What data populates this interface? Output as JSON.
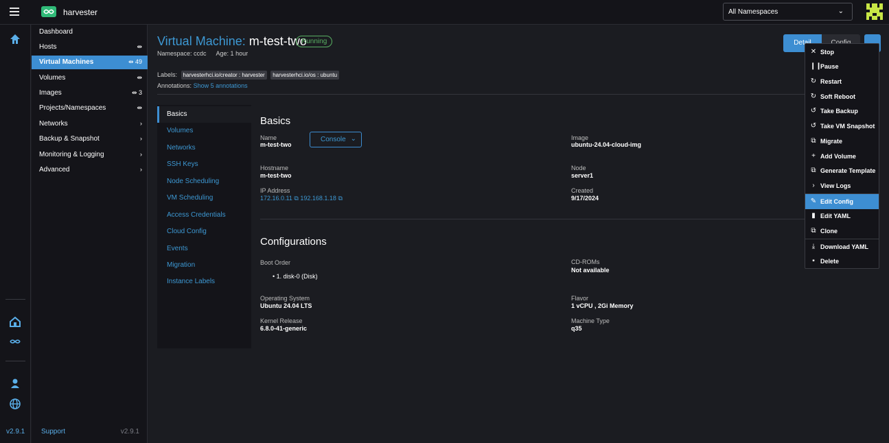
{
  "app": {
    "brand": "harvester",
    "namespace_select": "All Namespaces",
    "rail_version": "v2.9.1"
  },
  "sidebar": {
    "items": [
      {
        "label": "Dashboard",
        "count": ""
      },
      {
        "label": "Hosts",
        "count": "⇹"
      },
      {
        "label": "Virtual Machines",
        "count": "⇹ 49"
      },
      {
        "label": "Volumes",
        "count": "⇹"
      },
      {
        "label": "Images",
        "count": "⇹ 3"
      },
      {
        "label": "Projects/Namespaces",
        "count": "⇹"
      },
      {
        "label": "Networks",
        "count": "›"
      },
      {
        "label": "Backup & Snapshot",
        "count": "›"
      },
      {
        "label": "Monitoring & Logging",
        "count": "›"
      },
      {
        "label": "Advanced",
        "count": "›"
      }
    ],
    "support": "Support",
    "version": "v2.9.1"
  },
  "header": {
    "title_prefix": "Virtual Machine:",
    "title_name": "m-test-two",
    "status": "Running",
    "namespace": "Namespace: ccdc",
    "age": "Age: 1 hour",
    "labels_label": "Labels:",
    "label_tags": [
      "harvesterhci.io/creator : harvester",
      "harvesterhci.io/os : ubuntu"
    ],
    "annotations_label": "Annotations:",
    "annotations_link": "Show 5 annotations",
    "detail_button": "Detail",
    "config_button": "Config"
  },
  "tabs": [
    "Basics",
    "Volumes",
    "Networks",
    "SSH Keys",
    "Node Scheduling",
    "VM Scheduling",
    "Access Credentials",
    "Cloud Config",
    "Events",
    "Migration",
    "Instance Labels"
  ],
  "basics": {
    "heading": "Basics",
    "name_label": "Name",
    "name": "m-test-two",
    "console_button": "Console",
    "image_label": "Image",
    "image": "ubuntu-24.04-cloud-img",
    "hostname_label": "Hostname",
    "hostname": "m-test-two",
    "node_label": "Node",
    "node": "server1",
    "ip_label": "IP Address",
    "ip1": "172.16.0.11",
    "ip2": "192.168.1.18",
    "created_label": "Created",
    "created": "9/17/2024"
  },
  "configurations": {
    "heading": "Configurations",
    "boot_label": "Boot Order",
    "boot_item": "1. disk-0 (Disk)",
    "cdrom_label": "CD-ROMs",
    "cdrom": "Not available",
    "os_label": "Operating System",
    "os": "Ubuntu 24.04 LTS",
    "flavor_label": "Flavor",
    "flavor": "1 vCPU , 2Gi Memory",
    "kernel_label": "Kernel Release",
    "kernel": "6.8.0-41-generic",
    "machine_label": "Machine Type",
    "machine": "q35"
  },
  "menu": {
    "items": [
      "Stop",
      "Pause",
      "Restart",
      "Soft Reboot",
      "Take Backup",
      "Take VM Snapshot",
      "Migrate",
      "Add Volume",
      "Generate Template",
      "View Logs",
      "Edit Config",
      "Edit YAML",
      "Clone",
      "Download YAML",
      "Delete"
    ],
    "highlighted": "Edit Config"
  }
}
